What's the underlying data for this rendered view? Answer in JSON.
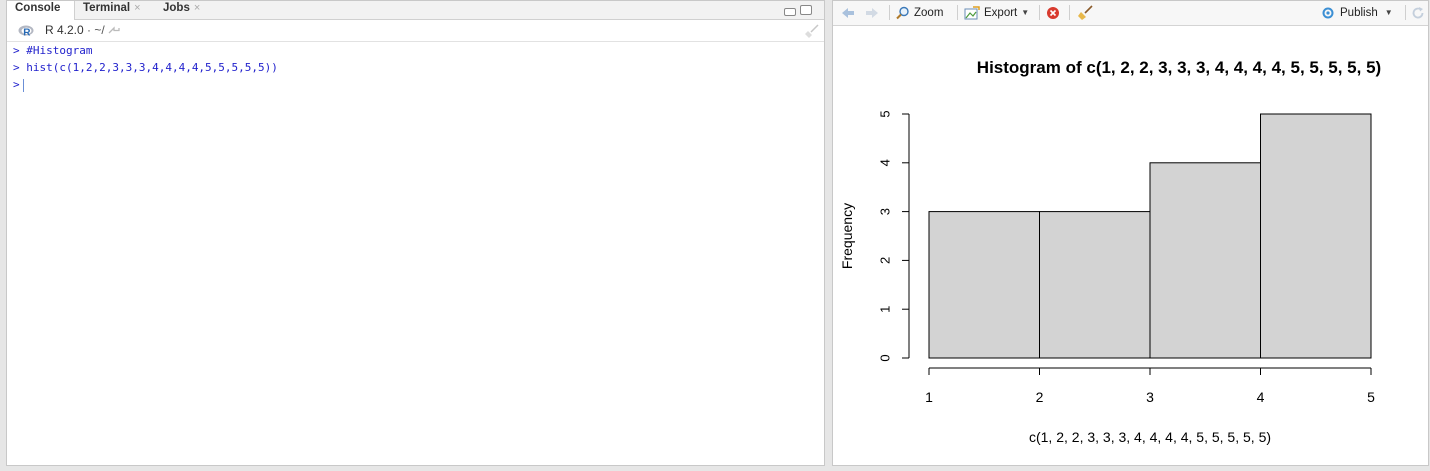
{
  "console_pane": {
    "tabs": [
      {
        "label": "Console"
      },
      {
        "label": "Terminal",
        "close": "×"
      },
      {
        "label": "Jobs",
        "close": "×"
      }
    ],
    "r_version": "R 4.2.0",
    "working_dir": "· ~/",
    "lines": [
      {
        "prompt": ">",
        "text": "#Histogram"
      },
      {
        "prompt": ">",
        "text": "hist(c(1,2,2,3,3,3,4,4,4,4,5,5,5,5,5))"
      },
      {
        "prompt": ">",
        "text": ""
      }
    ]
  },
  "plot_pane": {
    "toolbar": {
      "zoom": "Zoom",
      "export": "Export",
      "publish": "Publish"
    }
  },
  "chart_data": {
    "type": "bar",
    "title": "Histogram of c(1, 2, 2, 3, 3, 3, 4, 4, 4, 4, 5, 5, 5, 5, 5)",
    "xlabel": "c(1, 2, 2, 3, 3, 3, 4, 4, 4, 4, 5, 5, 5, 5, 5)",
    "ylabel": "Frequency",
    "bins": [
      [
        1,
        2
      ],
      [
        2,
        3
      ],
      [
        3,
        4
      ],
      [
        4,
        5
      ]
    ],
    "values": [
      3,
      3,
      4,
      5
    ],
    "x_ticks": [
      1,
      2,
      3,
      4,
      5
    ],
    "y_ticks": [
      0,
      1,
      2,
      3,
      4,
      5
    ],
    "xlim": [
      1,
      5
    ],
    "ylim": [
      0,
      5
    ],
    "bar_fill": "#d3d3d3",
    "grid": false
  }
}
